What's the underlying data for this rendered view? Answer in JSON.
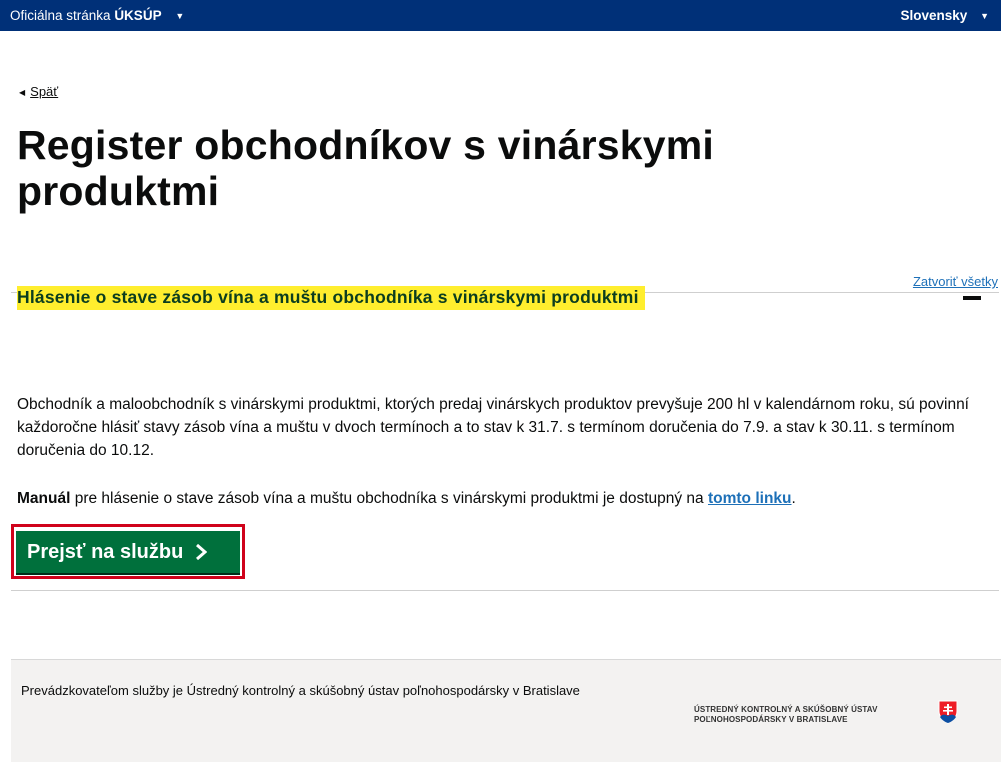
{
  "topbar": {
    "official_prefix": "Oficiálna stránka",
    "official_brand": "ÚKSÚP",
    "language": "Slovensky"
  },
  "nav": {
    "back_label": "Späť"
  },
  "page": {
    "title": "Register obchodníkov s vinárskymi produktmi"
  },
  "accordion": {
    "close_all": "Zatvoriť všetky",
    "section_title": "Hlásenie o stave zásob vína a muštu obchodníka s vinárskymi produktmi",
    "paragraph": "Obchodník a maloobchodník s vinárskymi produktmi, ktorých predaj vinárskych produktov prevyšuje 200 hl v kalendárnom roku, sú povinní každoročne hlásiť stavy zásob vína a muštu v dvoch termínoch a to stav k 31.7. s termínom doručenia do 7.9. a stav k 30.11. s termínom doručenia do 10.12.",
    "manual_bold": "Manuál",
    "manual_text": " pre hlásenie o stave zásob vína a muštu obchodníka s vinárskymi produktmi je dostupný na ",
    "manual_link": "tomto linku",
    "manual_end": ".",
    "service_button": "Prejsť na službu"
  },
  "footer": {
    "operator": "Prevádzkovateľom služby je Ústredný kontrolný a skúšobný ústav poľnohospodársky v Bratislave",
    "logo_line1": "ÚSTREDNÝ KONTROLNÝ A SKÚŠOBNÝ ÚSTAV",
    "logo_line2": "POĽNOHOSPODÁRSKY V BRATISLAVE"
  },
  "colors": {
    "topbar": "#003078",
    "highlight": "#ffee2e",
    "button": "#00703c",
    "link": "#1d70b8",
    "focus_frame": "#d0021b"
  },
  "icons": [
    "caret-down-icon",
    "back-triangle-icon",
    "minus-icon",
    "chevron-right-icon",
    "slovak-coat-of-arms-icon"
  ]
}
